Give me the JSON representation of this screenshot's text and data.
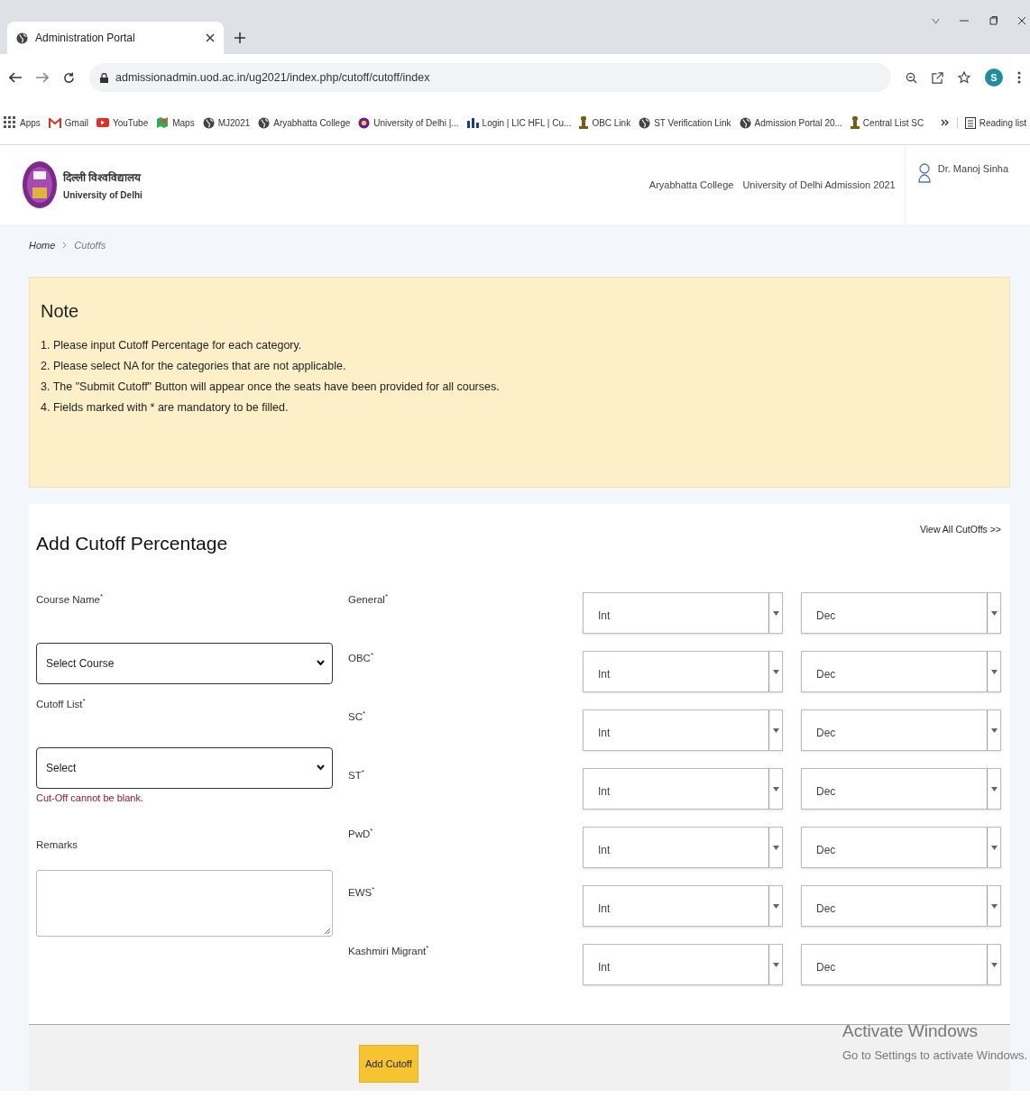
{
  "browser": {
    "tab": {
      "title": "Administration Portal"
    },
    "url": "admissionadmin.uod.ac.in/ug2021/index.php/cutoff/cutoff/index",
    "profile_initial": "S",
    "bookmarks": [
      {
        "label": "Apps",
        "kind": "grid"
      },
      {
        "label": "Gmail",
        "kind": "mail"
      },
      {
        "label": "YouTube",
        "kind": "video"
      },
      {
        "label": "Maps",
        "kind": "map"
      },
      {
        "label": "MJ2021",
        "kind": "site"
      },
      {
        "label": "Aryabhatta College",
        "kind": "site"
      },
      {
        "label": "University of Delhi |...",
        "kind": "seal"
      },
      {
        "label": "Login | LIC HFL | Cu...",
        "kind": "chart"
      },
      {
        "label": "OBC Link",
        "kind": "emblem"
      },
      {
        "label": "ST Verification Link",
        "kind": "site"
      },
      {
        "label": "Admission Portal 20...",
        "kind": "site"
      },
      {
        "label": "Central List SC",
        "kind": "emblem"
      }
    ],
    "reading_list": "Reading list"
  },
  "header": {
    "name_hindi": "दिल्ली विश्वविद्यालय",
    "name_english": "University of Delhi",
    "college": "Aryabhatta College",
    "portal_title": "University of Delhi Admission 2021",
    "user": "Dr. Manoj Sinha"
  },
  "breadcrumb": [
    "Home",
    "Cutoffs"
  ],
  "note": {
    "title": "Note",
    "items": [
      "1. Please input Cutoff Percentage for each category.",
      "2. Please select NA for the categories that are not applicable.",
      "3. The \"Submit Cutoff\" Button will appear once the seats have been provided for all courses.",
      "4. Fields marked with * are mandatory to be filled."
    ]
  },
  "form": {
    "title": "Add Cutoff Percentage",
    "view_all_link": "View All CutOffs >>",
    "fields": [
      {
        "kind": "select",
        "label": "Course Name$^{*}$",
        "value": "Select Course"
      },
      {
        "kind": "select",
        "label": "Cutoff List$^{*}$",
        "value": "Select",
        "error": "Cut-Off cannot be blank."
      },
      {
        "kind": "textarea",
        "label": "Remarks"
      }
    ],
    "categories": [
      {
        "name": "General$^{*}$",
        "int_placeholder": "Int",
        "dec_placeholder": "Dec"
      },
      {
        "name": "OBC$^{*}$",
        "int_placeholder": "Int",
        "dec_placeholder": "Dec"
      },
      {
        "name": "SC$^{*}$",
        "int_placeholder": "Int",
        "dec_placeholder": "Dec"
      },
      {
        "name": "ST$^{*}$",
        "int_placeholder": "Int",
        "dec_placeholder": "Dec"
      },
      {
        "name": "PwD$^{*}$",
        "int_placeholder": "Int",
        "dec_placeholder": "Dec"
      },
      {
        "name": "EWS$^{*}$",
        "int_placeholder": "Int",
        "dec_placeholder": "Dec"
      },
      {
        "name": "Kashmiri Migrant$^{*}$",
        "int_placeholder": "Int",
        "dec_placeholder": "Dec"
      }
    ],
    "submit_button": "Add Cutoff"
  },
  "windows_activation": {
    "title": "Activate Windows",
    "subtitle": "Go to Settings to activate Windows."
  }
}
